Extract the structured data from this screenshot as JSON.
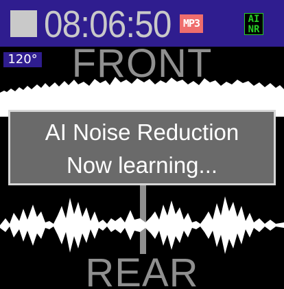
{
  "status": {
    "timecode": "08:06:50",
    "format_badge": "MP3",
    "ainr_badge_line1": "AI",
    "ainr_badge_line2": "NR"
  },
  "angle": "120°",
  "labels": {
    "front": "FRONT",
    "rear": "REAR"
  },
  "notice": {
    "line1": "AI Noise Reduction",
    "line2": "Now learning..."
  },
  "colors": {
    "status_bar_bg": "#2f1d8f",
    "notice_bg": "#6a6a6a",
    "label_gray": "#8f8f8f",
    "mp3_badge": "#ef6d6d",
    "ainr_badge": "#27cf27"
  },
  "icons": {
    "record_state": "stop-icon"
  }
}
